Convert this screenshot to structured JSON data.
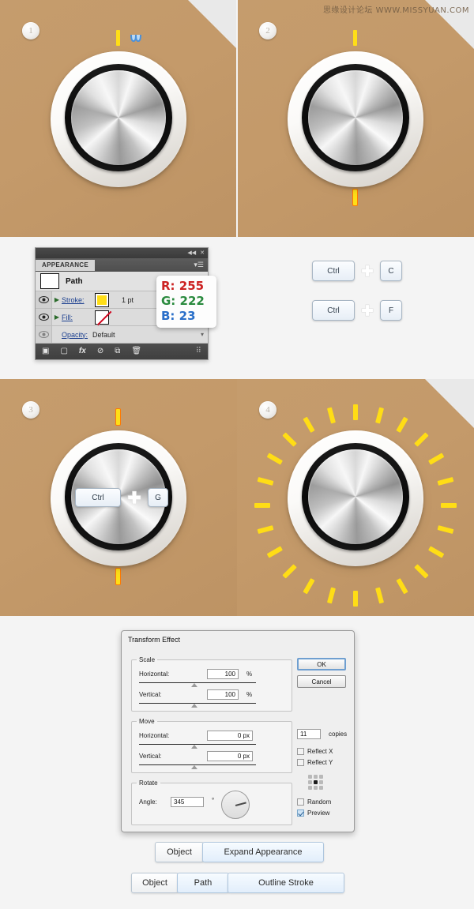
{
  "watermark": "思缘设计论坛 WWW.MISSYUAN.COM",
  "panels": [
    {
      "step": "1",
      "name": "knob-step-1"
    },
    {
      "step": "2",
      "name": "knob-step-2"
    },
    {
      "step": "3",
      "name": "knob-step-3"
    },
    {
      "step": "4",
      "name": "knob-step-4"
    }
  ],
  "appearance_panel": {
    "tab_label": "APPEARANCE",
    "collapse_glyph": "◀◀",
    "close_glyph": "✕",
    "menu_glyph": "▾☰",
    "object_title": "Path",
    "rows": [
      {
        "label": "Stroke:",
        "value": "1 pt",
        "swatch_color": "#ffde17"
      },
      {
        "label": "Fill:",
        "value": "",
        "swatch_color": "none"
      }
    ],
    "opacity_label": "Opacity:",
    "opacity_value": "Default",
    "footer_icons": [
      "new-fill-icon",
      "new-stroke-icon",
      "fx-icon",
      "clear-appearance-icon",
      "duplicate-icon",
      "delete-icon"
    ]
  },
  "rgb_callout": {
    "r_label": "R:",
    "r_value": "255",
    "r_color": "#cc2222",
    "g_label": "G:",
    "g_value": "222",
    "g_color": "#2a8a3e",
    "b_label": "B:",
    "b_value": "23",
    "b_color": "#2a6fc9"
  },
  "shortcuts": {
    "copy": {
      "modifier": "Ctrl",
      "plus": "+",
      "key": "C"
    },
    "paste_front": {
      "modifier": "Ctrl",
      "plus": "+",
      "key": "F"
    },
    "group": {
      "modifier": "Ctrl",
      "plus": "+",
      "key": "G"
    }
  },
  "transform_dialog": {
    "title": "Transform Effect",
    "scale": {
      "legend": "Scale",
      "horizontal_label": "Horizontal:",
      "horizontal_value": "100",
      "horizontal_unit": "%",
      "vertical_label": "Vertical:",
      "vertical_value": "100",
      "vertical_unit": "%"
    },
    "move": {
      "legend": "Move",
      "horizontal_label": "Horizontal:",
      "horizontal_value": "0 px",
      "vertical_label": "Vertical:",
      "vertical_value": "0 px"
    },
    "rotate": {
      "legend": "Rotate",
      "angle_label": "Angle:",
      "angle_value": "345",
      "angle_unit": "°"
    },
    "ok_label": "OK",
    "cancel_label": "Cancel",
    "copies_value": "11",
    "copies_label": "copies",
    "reflect_x_label": "Reflect X",
    "reflect_y_label": "Reflect Y",
    "random_label": "Random",
    "preview_label": "Preview",
    "reflect_x_checked": false,
    "reflect_y_checked": false,
    "random_checked": false,
    "preview_checked": true
  },
  "action_rows": {
    "row1": [
      {
        "label": "Object",
        "style": "gray"
      },
      {
        "label": "Expand Appearance",
        "style": "blue"
      }
    ],
    "row2": [
      {
        "label": "Object",
        "style": "gray"
      },
      {
        "label": "Path",
        "style": "blue"
      },
      {
        "label": "Outline Stroke",
        "style": "blue"
      }
    ]
  },
  "colors": {
    "background_tan": "#c49a6a",
    "tick_yellow": "#ffde17",
    "page_bg": "#f4f4f4"
  }
}
